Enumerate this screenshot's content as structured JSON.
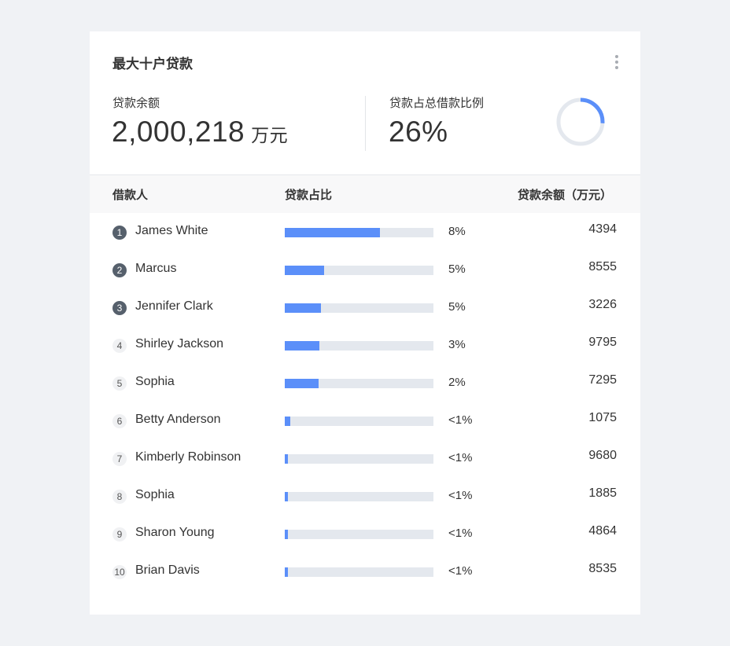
{
  "card": {
    "title": "最大十户贷款",
    "more_icon": "more-vertical-icon"
  },
  "stats": {
    "balance_label": "贷款余额",
    "balance_value": "2,000,218",
    "balance_unit": "万元",
    "ratio_label": "贷款占总借款比例",
    "ratio_value": "26%",
    "ratio_fraction": 0.26
  },
  "table": {
    "headers": {
      "borrower": "借款人",
      "share": "贷款占比",
      "amount": "贷款余额（万元）"
    },
    "rows": [
      {
        "rank": "1",
        "name": "James White",
        "share_fraction": 0.64,
        "pct": "8%",
        "amount": "4394"
      },
      {
        "rank": "2",
        "name": "Marcus",
        "share_fraction": 0.265,
        "pct": "5%",
        "amount": "8555"
      },
      {
        "rank": "3",
        "name": "Jennifer Clark",
        "share_fraction": 0.245,
        "pct": "5%",
        "amount": "3226"
      },
      {
        "rank": "4",
        "name": "Shirley Jackson",
        "share_fraction": 0.235,
        "pct": "3%",
        "amount": "9795"
      },
      {
        "rank": "5",
        "name": "Sophia",
        "share_fraction": 0.225,
        "pct": "2%",
        "amount": "7295"
      },
      {
        "rank": "6",
        "name": "Betty Anderson",
        "share_fraction": 0.035,
        "pct": "<1%",
        "amount": "1075"
      },
      {
        "rank": "7",
        "name": "Kimberly Robinson",
        "share_fraction": 0.02,
        "pct": "<1%",
        "amount": "9680"
      },
      {
        "rank": "8",
        "name": "Sophia",
        "share_fraction": 0.02,
        "pct": "<1%",
        "amount": "1885"
      },
      {
        "rank": "9",
        "name": "Sharon Young",
        "share_fraction": 0.02,
        "pct": "<1%",
        "amount": "4864"
      },
      {
        "rank": "10",
        "name": "Brian Davis",
        "share_fraction": 0.02,
        "pct": "<1%",
        "amount": "8535"
      }
    ]
  },
  "colors": {
    "accent": "#5b8ff9",
    "track": "#e4e8ee",
    "rank_top_bg": "#56606c"
  }
}
